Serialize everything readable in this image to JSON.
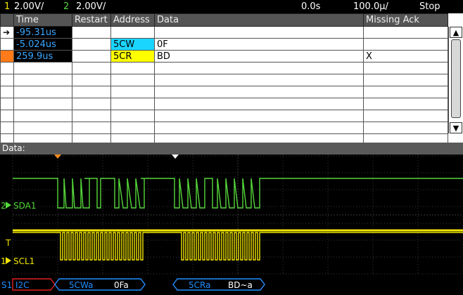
{
  "status": {
    "ch1_num": "1",
    "ch1_scale": "2.00V/",
    "ch2_num": "2",
    "ch2_scale": "2.00V/",
    "time_position": "0.0s",
    "time_scale": "100.0µ/",
    "run_state": "Stop"
  },
  "lister": {
    "headers": [
      "",
      "Time",
      "Restart",
      "Address",
      "Data",
      "Missing Ack"
    ],
    "rows": [
      {
        "marker": "arrow",
        "time": "-95.31us",
        "restart": "",
        "address": "",
        "address_type": "",
        "data": "",
        "missing_ack": ""
      },
      {
        "marker": "",
        "time": "-5.024us",
        "restart": "",
        "address": "5CW",
        "address_type": "write",
        "data": "0F",
        "missing_ack": ""
      },
      {
        "marker": "block",
        "time": "259.9us",
        "restart": "",
        "address": "5CR",
        "address_type": "read",
        "data": "BD",
        "missing_ack": "X"
      },
      {
        "marker": "",
        "time": "",
        "restart": "",
        "address": "",
        "address_type": "",
        "data": "",
        "missing_ack": ""
      },
      {
        "marker": "",
        "time": "",
        "restart": "",
        "address": "",
        "address_type": "",
        "data": "",
        "missing_ack": ""
      },
      {
        "marker": "",
        "time": "",
        "restart": "",
        "address": "",
        "address_type": "",
        "data": "",
        "missing_ack": ""
      },
      {
        "marker": "",
        "time": "",
        "restart": "",
        "address": "",
        "address_type": "",
        "data": "",
        "missing_ack": ""
      },
      {
        "marker": "",
        "time": "",
        "restart": "",
        "address": "",
        "address_type": "",
        "data": "",
        "missing_ack": ""
      },
      {
        "marker": "",
        "time": "",
        "restart": "",
        "address": "",
        "address_type": "",
        "data": "",
        "missing_ack": ""
      },
      {
        "marker": "",
        "time": "",
        "restart": "",
        "address": "",
        "address_type": "",
        "data": "",
        "missing_ack": ""
      }
    ]
  },
  "data_label": "Data:",
  "waveforms": {
    "ch1_label": "SDA1",
    "ch1_ref": "2",
    "ch2_label": "SCL1",
    "ch2_ref": "1",
    "trigger_mark": "T"
  },
  "decode": {
    "bus_ref": "S1",
    "bus_name": "I2C",
    "frame1_addr": "5CWa",
    "frame1_data": "0Fa",
    "frame2_addr": "5CRa",
    "frame2_data": "BD~a"
  },
  "colors": {
    "sda": "#55d83a",
    "scl": "#f2e600",
    "decode": "#1f8fff",
    "error": "#e02020",
    "marker": "#ff8a1e"
  }
}
